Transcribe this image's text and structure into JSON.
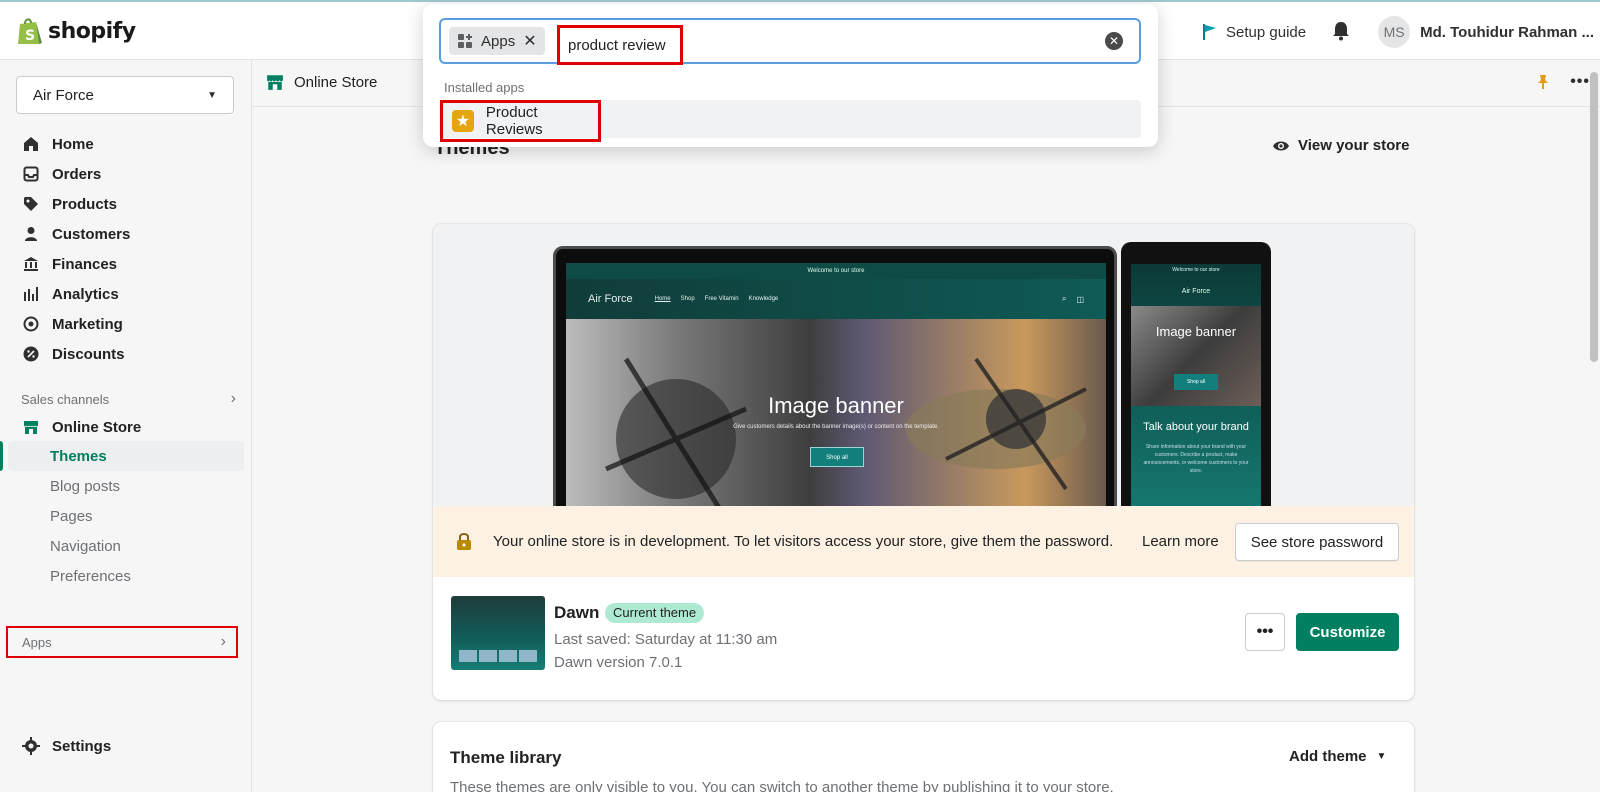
{
  "topbar": {
    "logo_text": "shopify",
    "setup_guide": "Setup guide",
    "avatar_initials": "MS",
    "user_name": "Md. Touhidur Rahman ..."
  },
  "sidebar": {
    "store_name": "Air Force",
    "items": [
      {
        "label": "Home",
        "icon": "home-icon"
      },
      {
        "label": "Orders",
        "icon": "inbox-icon"
      },
      {
        "label": "Products",
        "icon": "tag-icon"
      },
      {
        "label": "Customers",
        "icon": "person-icon"
      },
      {
        "label": "Finances",
        "icon": "bank-icon"
      },
      {
        "label": "Analytics",
        "icon": "bar-chart-icon"
      },
      {
        "label": "Marketing",
        "icon": "target-icon"
      },
      {
        "label": "Discounts",
        "icon": "discount-icon"
      }
    ],
    "sales_channels_label": "Sales channels",
    "online_store_label": "Online Store",
    "sub_items": [
      "Themes",
      "Blog posts",
      "Pages",
      "Navigation",
      "Preferences"
    ],
    "apps_label": "Apps",
    "settings_label": "Settings"
  },
  "breadcrumb": {
    "label": "Online Store"
  },
  "page": {
    "title": "Themes",
    "view_store": "View your store"
  },
  "preview": {
    "announcement": "Welcome to our store",
    "brand": "Air Force",
    "nav": [
      "Home",
      "Shop",
      "Free Vitamin",
      "Knowledge"
    ],
    "banner_title": "Image banner",
    "banner_subtitle": "Give customers details about the banner image(s) or content on the template.",
    "banner_button": "Shop all",
    "phone_talk_title": "Talk about your brand",
    "phone_talk_desc": "Share information about your brand with your customers. Describe a product, make announcements, or welcome customers to your store."
  },
  "dev_banner": {
    "text": "Your online store is in development. To let visitors access your store, give them the password.",
    "learn_more": "Learn more",
    "button": "See store password"
  },
  "current_theme": {
    "name": "Dawn",
    "badge": "Current theme",
    "last_saved": "Last saved: Saturday at 11:30 am",
    "version": "Dawn version 7.0.1",
    "more_label": "•••",
    "customize_label": "Customize"
  },
  "library": {
    "title": "Theme library",
    "description": "These themes are only visible to you. You can switch to another theme by publishing it to your store.",
    "add_theme": "Add theme"
  },
  "search": {
    "chip_label": "Apps",
    "query": "product review",
    "section_label": "Installed apps",
    "result_label": "Product Reviews"
  },
  "colors": {
    "accent": "#008060",
    "highlight": "#e00000",
    "badge": "#aee9d1",
    "dev_banner_bg": "#fdf1e3"
  }
}
